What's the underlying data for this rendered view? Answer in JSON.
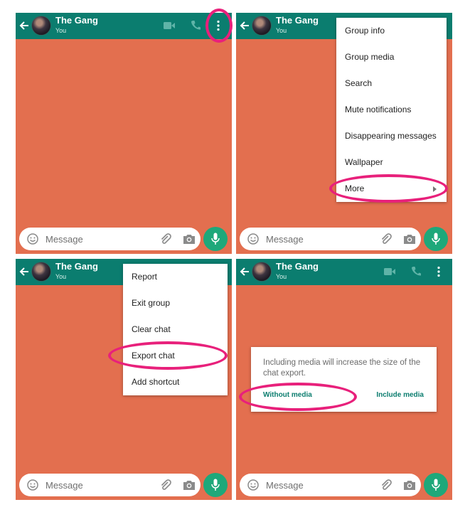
{
  "chat": {
    "title": "The Gang",
    "subtitle": "You",
    "message_placeholder": "Message"
  },
  "menu_main": {
    "items": [
      {
        "label": "Group info"
      },
      {
        "label": "Group media"
      },
      {
        "label": "Search"
      },
      {
        "label": "Mute notifications"
      },
      {
        "label": "Disappearing messages"
      },
      {
        "label": "Wallpaper"
      },
      {
        "label": "More"
      }
    ]
  },
  "menu_more": {
    "items": [
      {
        "label": "Report"
      },
      {
        "label": "Exit group"
      },
      {
        "label": "Clear chat"
      },
      {
        "label": "Export chat"
      },
      {
        "label": "Add shortcut"
      }
    ]
  },
  "export_dialog": {
    "message": "Including media will increase the size of the chat export.",
    "without_media_label": "Without media",
    "include_media_label": "Include media"
  },
  "colors": {
    "header": "#0b7d6f",
    "wallpaper": "#e36f4f",
    "mic_button": "#1ea87a",
    "highlight": "#e8207b",
    "dialog_button_text": "#0b7d6f"
  },
  "icons": {
    "back": "arrow-left",
    "video": "video-camera",
    "call": "phone",
    "menu": "more-vertical",
    "emoji": "smiley",
    "attach": "paperclip",
    "camera": "camera",
    "mic": "microphone",
    "submenu": "caret-right"
  }
}
